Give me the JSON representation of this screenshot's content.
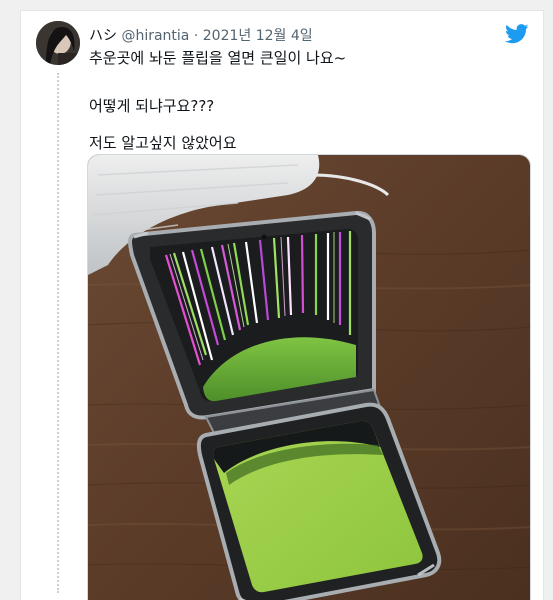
{
  "tweet": {
    "display_name": "ハシ",
    "handle": "@hirantia",
    "separator": "·",
    "date": "2021년 12월 4일",
    "lines": [
      "추운곳에 놔둔 플립을 열면 큰일이 나요~",
      "어떻게 되냐구요???",
      "저도 알고싶지 않았어요"
    ]
  },
  "icons": {
    "brand": "twitter-bird-icon",
    "brand_color": "#1d9bf0"
  }
}
